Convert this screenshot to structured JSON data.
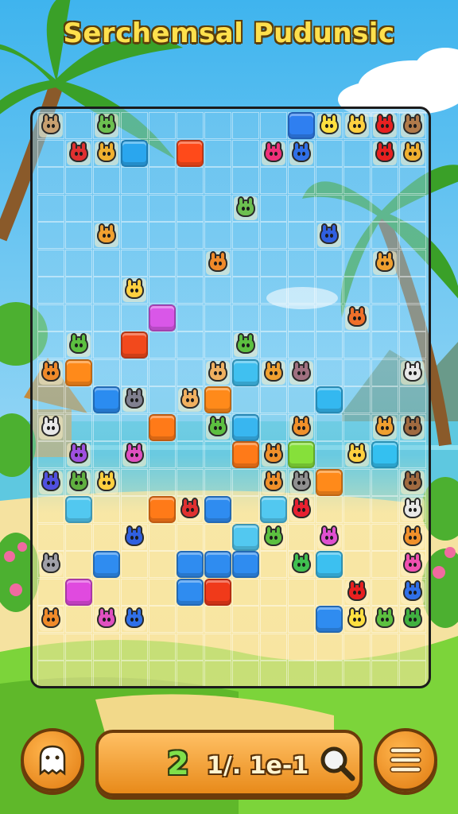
{
  "game": {
    "title": "Serchemsal Pudunsic",
    "score_number": "2",
    "score_text": "1/. 1e-1"
  },
  "colors": {
    "sky": "#5fc4ee",
    "grass": "#7cd43a",
    "sand": "#f5e2a0",
    "board_border": "#1b1b1b",
    "button_orange": "#f0961f"
  },
  "board": {
    "cols": 14,
    "rows": 21,
    "tiles": [
      {
        "c": 9,
        "r": 0,
        "color": "#2f7ff0"
      },
      {
        "c": 3,
        "r": 1,
        "color": "#2aa6ee"
      },
      {
        "c": 5,
        "r": 1,
        "color": "#ff4a1a"
      },
      {
        "c": 4,
        "r": 7,
        "color": "#d957e8"
      },
      {
        "c": 3,
        "r": 8,
        "color": "#f2491c"
      },
      {
        "c": 1,
        "r": 9,
        "color": "#ff8a1a"
      },
      {
        "c": 7,
        "r": 9,
        "color": "#40c0f0"
      },
      {
        "c": 2,
        "r": 10,
        "color": "#2b8cf0"
      },
      {
        "c": 6,
        "r": 10,
        "color": "#ff8a1a"
      },
      {
        "c": 10,
        "r": 10,
        "color": "#34b8f0"
      },
      {
        "c": 4,
        "r": 11,
        "color": "#ff7a18"
      },
      {
        "c": 7,
        "r": 11,
        "color": "#38b6f0"
      },
      {
        "c": 7,
        "r": 12,
        "color": "#ff7a18"
      },
      {
        "c": 9,
        "r": 12,
        "color": "#86e03a"
      },
      {
        "c": 12,
        "r": 12,
        "color": "#34c0f0"
      },
      {
        "c": 10,
        "r": 13,
        "color": "#ff8a1a"
      },
      {
        "c": 1,
        "r": 14,
        "color": "#52c8f0"
      },
      {
        "c": 4,
        "r": 14,
        "color": "#ff7a18"
      },
      {
        "c": 6,
        "r": 14,
        "color": "#2f8cf0"
      },
      {
        "c": 8,
        "r": 14,
        "color": "#52c8f0"
      },
      {
        "c": 7,
        "r": 15,
        "color": "#52c8f0"
      },
      {
        "c": 2,
        "r": 16,
        "color": "#2f8cf0"
      },
      {
        "c": 5,
        "r": 16,
        "color": "#2f8cf0"
      },
      {
        "c": 6,
        "r": 16,
        "color": "#2f8cf0"
      },
      {
        "c": 7,
        "r": 16,
        "color": "#2f8cf0"
      },
      {
        "c": 10,
        "r": 16,
        "color": "#3cc0f0"
      },
      {
        "c": 1,
        "r": 17,
        "color": "#e04adf"
      },
      {
        "c": 5,
        "r": 17,
        "color": "#2f8cf0"
      },
      {
        "c": 6,
        "r": 17,
        "color": "#f03a1a"
      },
      {
        "c": 10,
        "r": 18,
        "color": "#2f8cf0"
      }
    ],
    "critters": [
      {
        "c": 0,
        "r": 0,
        "color": "#c8a070"
      },
      {
        "c": 2,
        "r": 0,
        "color": "#6cc050"
      },
      {
        "c": 10,
        "r": 0,
        "color": "#ffe040"
      },
      {
        "c": 11,
        "r": 0,
        "color": "#ffd040"
      },
      {
        "c": 12,
        "r": 0,
        "color": "#e82020"
      },
      {
        "c": 13,
        "r": 0,
        "color": "#b07a4a"
      },
      {
        "c": 1,
        "r": 1,
        "color": "#e03030"
      },
      {
        "c": 2,
        "r": 1,
        "color": "#f0b030"
      },
      {
        "c": 8,
        "r": 1,
        "color": "#f0307a"
      },
      {
        "c": 9,
        "r": 1,
        "color": "#3070e8"
      },
      {
        "c": 12,
        "r": 1,
        "color": "#e82020"
      },
      {
        "c": 13,
        "r": 1,
        "color": "#f0b030"
      },
      {
        "c": 7,
        "r": 3,
        "color": "#6cc050"
      },
      {
        "c": 2,
        "r": 4,
        "color": "#f0a030"
      },
      {
        "c": 10,
        "r": 4,
        "color": "#3060e0"
      },
      {
        "c": 6,
        "r": 5,
        "color": "#f08a2a"
      },
      {
        "c": 12,
        "r": 5,
        "color": "#f0a030"
      },
      {
        "c": 3,
        "r": 6,
        "color": "#ffd040"
      },
      {
        "c": 11,
        "r": 7,
        "color": "#f0702a"
      },
      {
        "c": 1,
        "r": 8,
        "color": "#5cc040"
      },
      {
        "c": 7,
        "r": 8,
        "color": "#5cc040"
      },
      {
        "c": 0,
        "r": 9,
        "color": "#f08a2a"
      },
      {
        "c": 6,
        "r": 9,
        "color": "#f0b060"
      },
      {
        "c": 8,
        "r": 9,
        "color": "#f0a030"
      },
      {
        "c": 9,
        "r": 9,
        "color": "#a07080"
      },
      {
        "c": 13,
        "r": 9,
        "color": "#e8e8e8"
      },
      {
        "c": 3,
        "r": 10,
        "color": "#808090"
      },
      {
        "c": 5,
        "r": 10,
        "color": "#f0b060"
      },
      {
        "c": 0,
        "r": 11,
        "color": "#e8e8e8"
      },
      {
        "c": 6,
        "r": 11,
        "color": "#5cc040"
      },
      {
        "c": 9,
        "r": 11,
        "color": "#f0902a"
      },
      {
        "c": 12,
        "r": 11,
        "color": "#f0a030"
      },
      {
        "c": 13,
        "r": 11,
        "color": "#a06a40"
      },
      {
        "c": 1,
        "r": 12,
        "color": "#a050e0"
      },
      {
        "c": 3,
        "r": 12,
        "color": "#e050c0"
      },
      {
        "c": 8,
        "r": 12,
        "color": "#f0902a"
      },
      {
        "c": 11,
        "r": 12,
        "color": "#ffd040"
      },
      {
        "c": 0,
        "r": 13,
        "color": "#5050e0"
      },
      {
        "c": 1,
        "r": 13,
        "color": "#60b040"
      },
      {
        "c": 2,
        "r": 13,
        "color": "#ffd040"
      },
      {
        "c": 8,
        "r": 13,
        "color": "#f0902a"
      },
      {
        "c": 9,
        "r": 13,
        "color": "#909090"
      },
      {
        "c": 13,
        "r": 13,
        "color": "#a06a40"
      },
      {
        "c": 5,
        "r": 14,
        "color": "#e03030"
      },
      {
        "c": 9,
        "r": 14,
        "color": "#e82030"
      },
      {
        "c": 13,
        "r": 14,
        "color": "#e8e8e8"
      },
      {
        "c": 3,
        "r": 15,
        "color": "#3060e0"
      },
      {
        "c": 8,
        "r": 15,
        "color": "#5cc040"
      },
      {
        "c": 10,
        "r": 15,
        "color": "#e050d0"
      },
      {
        "c": 13,
        "r": 15,
        "color": "#f0902a"
      },
      {
        "c": 0,
        "r": 16,
        "color": "#a0a0a8"
      },
      {
        "c": 9,
        "r": 16,
        "color": "#40c050"
      },
      {
        "c": 13,
        "r": 16,
        "color": "#f050b0"
      },
      {
        "c": 11,
        "r": 17,
        "color": "#e82020"
      },
      {
        "c": 13,
        "r": 17,
        "color": "#3070e8"
      },
      {
        "c": 0,
        "r": 18,
        "color": "#f08a2a"
      },
      {
        "c": 2,
        "r": 18,
        "color": "#e050c0"
      },
      {
        "c": 3,
        "r": 18,
        "color": "#3070e8"
      },
      {
        "c": 11,
        "r": 18,
        "color": "#ffe040"
      },
      {
        "c": 12,
        "r": 18,
        "color": "#5cc040"
      },
      {
        "c": 13,
        "r": 18,
        "color": "#40b040"
      }
    ]
  },
  "buttons": {
    "left_icon": "ghost-icon",
    "search_icon": "magnifier-icon",
    "menu_icon": "hamburger-menu-icon"
  }
}
